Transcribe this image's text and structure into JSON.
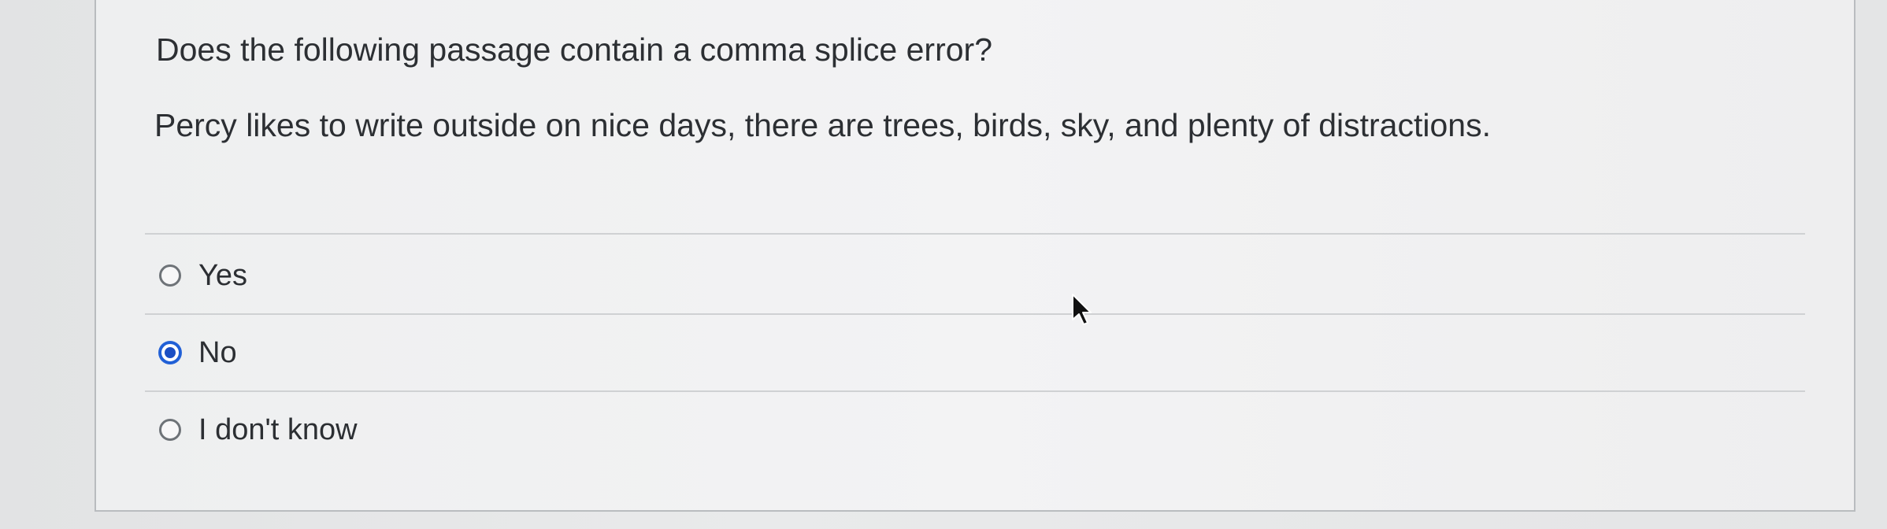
{
  "question": {
    "prompt": "Does the following passage contain a comma splice error?",
    "passage": "Percy likes to write outside on nice days, there are trees, birds, sky, and plenty of distractions."
  },
  "options": [
    {
      "label": "Yes",
      "selected": false
    },
    {
      "label": "No",
      "selected": true
    },
    {
      "label": "I don't know",
      "selected": false
    }
  ],
  "colors": {
    "selected_radio": "#1f5fd6",
    "text": "#2c2f33"
  },
  "icons": {
    "cursor": "mouse-pointer-icon"
  }
}
